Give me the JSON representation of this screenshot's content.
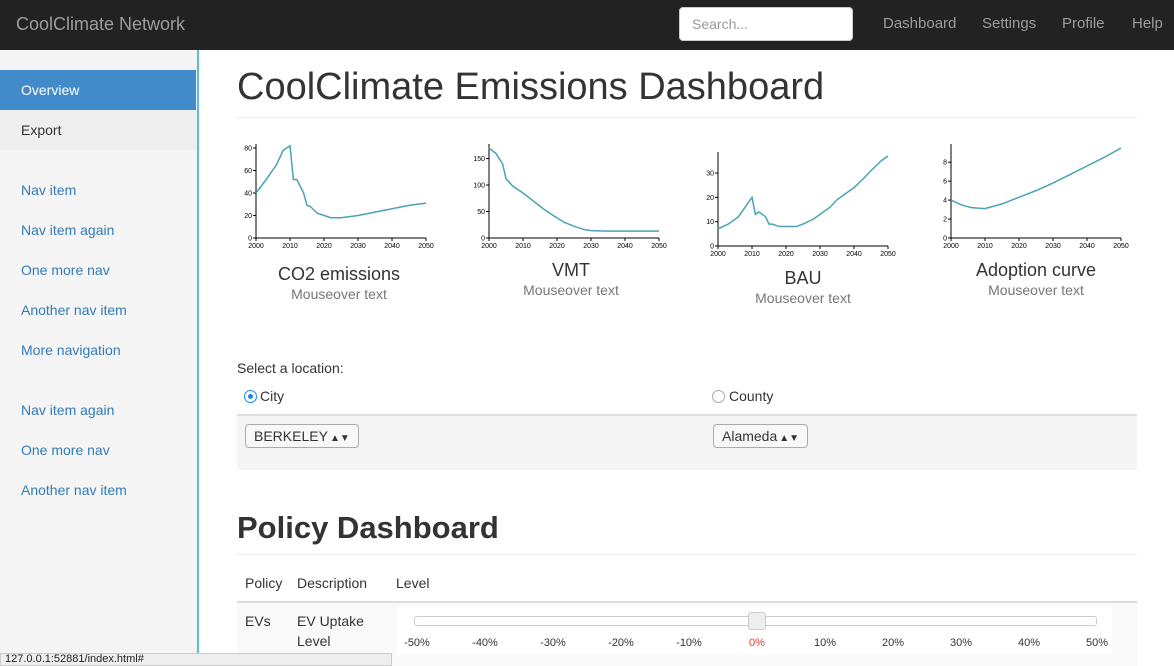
{
  "navbar": {
    "brand": "CoolClimate Network",
    "search_placeholder": "Search...",
    "links": [
      "Dashboard",
      "Settings",
      "Profile",
      "Help"
    ]
  },
  "sidebar": {
    "items": [
      {
        "label": "Overview",
        "state": "active"
      },
      {
        "label": "Export",
        "state": "plain"
      },
      {
        "label": "Nav item",
        "state": "link"
      },
      {
        "label": "Nav item again",
        "state": "link"
      },
      {
        "label": "One more nav",
        "state": "link"
      },
      {
        "label": "Another nav item",
        "state": "link"
      },
      {
        "label": "More navigation",
        "state": "link"
      },
      {
        "label": "Nav item again",
        "state": "link"
      },
      {
        "label": "One more nav",
        "state": "link"
      },
      {
        "label": "Another nav item",
        "state": "link"
      }
    ]
  },
  "main": {
    "title": "CoolClimate Emissions Dashboard",
    "location_label": "Select a location:",
    "city_option": "City",
    "county_option": "County",
    "selected_option": "City",
    "city_value": "BERKELEY",
    "county_value": "Alameda",
    "policy_title": "Policy Dashboard",
    "table_headers": [
      "Policy",
      "Description",
      "Level"
    ],
    "row": {
      "policy": "EVs",
      "description_line1": "EV Uptake",
      "description_line2": "Level",
      "slider_value_percent": 0,
      "ticks": [
        "-50%",
        "-40%",
        "-30%",
        "-20%",
        "-10%",
        "0%",
        "10%",
        "20%",
        "30%",
        "40%",
        "50%"
      ]
    }
  },
  "status_url": "127.0.0.1:52881/index.html#",
  "colors": {
    "line": "#4aa3b5",
    "navbar": "#222222",
    "active": "#428bca",
    "highlight_tick": "#e53935"
  },
  "chart_data": [
    {
      "type": "line",
      "title": "CO2 emissions",
      "subtitle": "Mouseover text",
      "x": [
        2000,
        2003,
        2006,
        2008,
        2010,
        2011,
        2012,
        2013,
        2014,
        2015,
        2016,
        2018,
        2020,
        2022,
        2025,
        2030,
        2035,
        2040,
        2045,
        2050
      ],
      "y": [
        40,
        52,
        65,
        78,
        82,
        52,
        52,
        46,
        40,
        29,
        28,
        22,
        20,
        18,
        18,
        20,
        23,
        26,
        29,
        31
      ],
      "xlim": [
        2000,
        2050
      ],
      "ylim": [
        0,
        80
      ],
      "xticks": [
        2000,
        2010,
        2020,
        2030,
        2040,
        2050
      ],
      "yticks": [
        0,
        20,
        40,
        60,
        80
      ]
    },
    {
      "type": "line",
      "title": "VMT",
      "subtitle": "Mouseover text",
      "x": [
        2000,
        2002,
        2004,
        2005,
        2007,
        2010,
        2013,
        2016,
        2019,
        2022,
        2025,
        2028,
        2030,
        2035,
        2040,
        2045,
        2050
      ],
      "y": [
        170,
        160,
        140,
        112,
        98,
        85,
        70,
        55,
        42,
        30,
        22,
        16,
        14,
        13,
        13,
        13,
        13
      ],
      "xlim": [
        2000,
        2050
      ],
      "ylim": [
        0,
        170
      ],
      "xticks": [
        2000,
        2010,
        2020,
        2030,
        2040,
        2050
      ],
      "yticks": [
        0,
        50,
        100,
        150
      ]
    },
    {
      "type": "line",
      "title": "BAU",
      "subtitle": "Mouseover text",
      "x": [
        2000,
        2003,
        2006,
        2008,
        2010,
        2011,
        2012,
        2013,
        2014,
        2015,
        2016,
        2018,
        2020,
        2023,
        2025,
        2028,
        2030,
        2033,
        2035,
        2038,
        2040,
        2043,
        2045,
        2048,
        2050
      ],
      "y": [
        7,
        9,
        12,
        16,
        20,
        13,
        14,
        13,
        12,
        9,
        9,
        8,
        8,
        8,
        9,
        11,
        13,
        16,
        19,
        22,
        24,
        28,
        31,
        35,
        37
      ],
      "xlim": [
        2000,
        2050
      ],
      "ylim": [
        0,
        37
      ],
      "xticks": [
        2000,
        2010,
        2020,
        2030,
        2040,
        2050
      ],
      "yticks": [
        0,
        10,
        20,
        30
      ]
    },
    {
      "type": "line",
      "title": "Adoption curve",
      "subtitle": "Mouseover text",
      "x": [
        2000,
        2003,
        2006,
        2010,
        2015,
        2020,
        2025,
        2030,
        2035,
        2040,
        2045,
        2050
      ],
      "y": [
        4,
        3.5,
        3.2,
        3.1,
        3.6,
        4.3,
        5.0,
        5.8,
        6.7,
        7.6,
        8.5,
        9.5
      ],
      "xlim": [
        2000,
        2050
      ],
      "ylim": [
        0,
        9.5
      ],
      "xticks": [
        2000,
        2010,
        2020,
        2030,
        2040,
        2050
      ],
      "yticks": [
        0,
        2,
        4,
        6,
        8
      ]
    }
  ]
}
